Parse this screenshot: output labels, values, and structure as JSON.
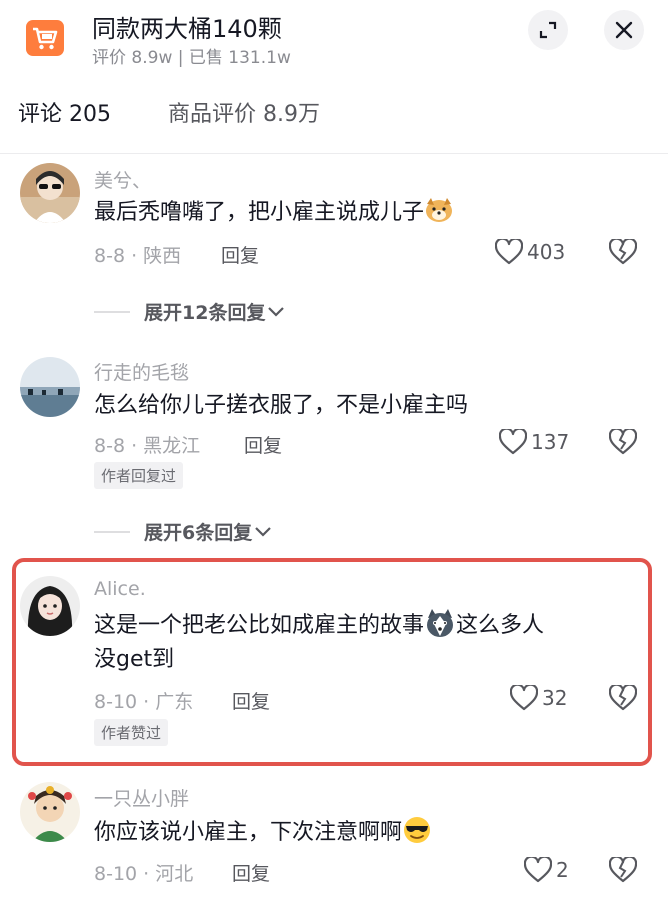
{
  "header": {
    "title": "同款两大桶140颗",
    "subtitle": "评价 8.9w | 已售 131.1w",
    "icons": {
      "cart": "shopping-cart-icon",
      "expand": "expand-icon",
      "close": "close-icon"
    }
  },
  "tabs": [
    {
      "label": "评论 205",
      "active": true
    },
    {
      "label": "商品评价 8.9万",
      "active": false
    }
  ],
  "labels": {
    "reply": "回复"
  },
  "colors": {
    "brand_orange": "#fe7d3d",
    "highlight": "#e1544c",
    "text_primary": "#161823",
    "text_muted": "#a3a4a9"
  },
  "comments": [
    {
      "user": "美兮、",
      "text": "最后秃噜嘴了，把小雇主说成儿子",
      "emoji": "dog-emoji-icon",
      "date": "8-8 · 陕西",
      "likes": "403",
      "expand": "展开12条回复"
    },
    {
      "user": "行走的毛毯",
      "text": "怎么给你儿子搓衣服了，不是小雇主吗",
      "date": "8-8 · 黑龙江",
      "likes": "137",
      "tag": "作者回复过",
      "expand": "展开6条回复"
    },
    {
      "user": "Alice.",
      "text_line1": "这是一个把老公比如成雇主的故事",
      "text_line1_after": "这么多人",
      "text_line2": "没get到",
      "emoji": "husky-emoji-icon",
      "date": "8-10 · 广东",
      "likes": "32",
      "tag": "作者赞过",
      "highlighted": true
    },
    {
      "user": "一只丛小胖",
      "text": "你应该说小雇主，下次注意啊啊",
      "emoji": "sunglasses-emoji-icon",
      "date": "8-10 · 河北",
      "likes": "2"
    }
  ]
}
